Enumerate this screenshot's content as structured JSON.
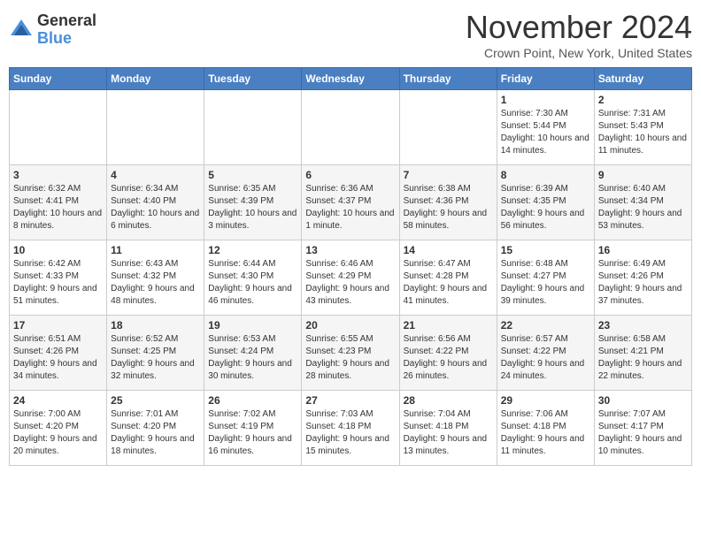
{
  "logo": {
    "general": "General",
    "blue": "Blue"
  },
  "title": "November 2024",
  "location": "Crown Point, New York, United States",
  "days_of_week": [
    "Sunday",
    "Monday",
    "Tuesday",
    "Wednesday",
    "Thursday",
    "Friday",
    "Saturday"
  ],
  "weeks": [
    [
      {
        "day": "",
        "info": ""
      },
      {
        "day": "",
        "info": ""
      },
      {
        "day": "",
        "info": ""
      },
      {
        "day": "",
        "info": ""
      },
      {
        "day": "",
        "info": ""
      },
      {
        "day": "1",
        "info": "Sunrise: 7:30 AM\nSunset: 5:44 PM\nDaylight: 10 hours and 14 minutes."
      },
      {
        "day": "2",
        "info": "Sunrise: 7:31 AM\nSunset: 5:43 PM\nDaylight: 10 hours and 11 minutes."
      }
    ],
    [
      {
        "day": "3",
        "info": "Sunrise: 6:32 AM\nSunset: 4:41 PM\nDaylight: 10 hours and 8 minutes."
      },
      {
        "day": "4",
        "info": "Sunrise: 6:34 AM\nSunset: 4:40 PM\nDaylight: 10 hours and 6 minutes."
      },
      {
        "day": "5",
        "info": "Sunrise: 6:35 AM\nSunset: 4:39 PM\nDaylight: 10 hours and 3 minutes."
      },
      {
        "day": "6",
        "info": "Sunrise: 6:36 AM\nSunset: 4:37 PM\nDaylight: 10 hours and 1 minute."
      },
      {
        "day": "7",
        "info": "Sunrise: 6:38 AM\nSunset: 4:36 PM\nDaylight: 9 hours and 58 minutes."
      },
      {
        "day": "8",
        "info": "Sunrise: 6:39 AM\nSunset: 4:35 PM\nDaylight: 9 hours and 56 minutes."
      },
      {
        "day": "9",
        "info": "Sunrise: 6:40 AM\nSunset: 4:34 PM\nDaylight: 9 hours and 53 minutes."
      }
    ],
    [
      {
        "day": "10",
        "info": "Sunrise: 6:42 AM\nSunset: 4:33 PM\nDaylight: 9 hours and 51 minutes."
      },
      {
        "day": "11",
        "info": "Sunrise: 6:43 AM\nSunset: 4:32 PM\nDaylight: 9 hours and 48 minutes."
      },
      {
        "day": "12",
        "info": "Sunrise: 6:44 AM\nSunset: 4:30 PM\nDaylight: 9 hours and 46 minutes."
      },
      {
        "day": "13",
        "info": "Sunrise: 6:46 AM\nSunset: 4:29 PM\nDaylight: 9 hours and 43 minutes."
      },
      {
        "day": "14",
        "info": "Sunrise: 6:47 AM\nSunset: 4:28 PM\nDaylight: 9 hours and 41 minutes."
      },
      {
        "day": "15",
        "info": "Sunrise: 6:48 AM\nSunset: 4:27 PM\nDaylight: 9 hours and 39 minutes."
      },
      {
        "day": "16",
        "info": "Sunrise: 6:49 AM\nSunset: 4:26 PM\nDaylight: 9 hours and 37 minutes."
      }
    ],
    [
      {
        "day": "17",
        "info": "Sunrise: 6:51 AM\nSunset: 4:26 PM\nDaylight: 9 hours and 34 minutes."
      },
      {
        "day": "18",
        "info": "Sunrise: 6:52 AM\nSunset: 4:25 PM\nDaylight: 9 hours and 32 minutes."
      },
      {
        "day": "19",
        "info": "Sunrise: 6:53 AM\nSunset: 4:24 PM\nDaylight: 9 hours and 30 minutes."
      },
      {
        "day": "20",
        "info": "Sunrise: 6:55 AM\nSunset: 4:23 PM\nDaylight: 9 hours and 28 minutes."
      },
      {
        "day": "21",
        "info": "Sunrise: 6:56 AM\nSunset: 4:22 PM\nDaylight: 9 hours and 26 minutes."
      },
      {
        "day": "22",
        "info": "Sunrise: 6:57 AM\nSunset: 4:22 PM\nDaylight: 9 hours and 24 minutes."
      },
      {
        "day": "23",
        "info": "Sunrise: 6:58 AM\nSunset: 4:21 PM\nDaylight: 9 hours and 22 minutes."
      }
    ],
    [
      {
        "day": "24",
        "info": "Sunrise: 7:00 AM\nSunset: 4:20 PM\nDaylight: 9 hours and 20 minutes."
      },
      {
        "day": "25",
        "info": "Sunrise: 7:01 AM\nSunset: 4:20 PM\nDaylight: 9 hours and 18 minutes."
      },
      {
        "day": "26",
        "info": "Sunrise: 7:02 AM\nSunset: 4:19 PM\nDaylight: 9 hours and 16 minutes."
      },
      {
        "day": "27",
        "info": "Sunrise: 7:03 AM\nSunset: 4:18 PM\nDaylight: 9 hours and 15 minutes."
      },
      {
        "day": "28",
        "info": "Sunrise: 7:04 AM\nSunset: 4:18 PM\nDaylight: 9 hours and 13 minutes."
      },
      {
        "day": "29",
        "info": "Sunrise: 7:06 AM\nSunset: 4:18 PM\nDaylight: 9 hours and 11 minutes."
      },
      {
        "day": "30",
        "info": "Sunrise: 7:07 AM\nSunset: 4:17 PM\nDaylight: 9 hours and 10 minutes."
      }
    ]
  ]
}
